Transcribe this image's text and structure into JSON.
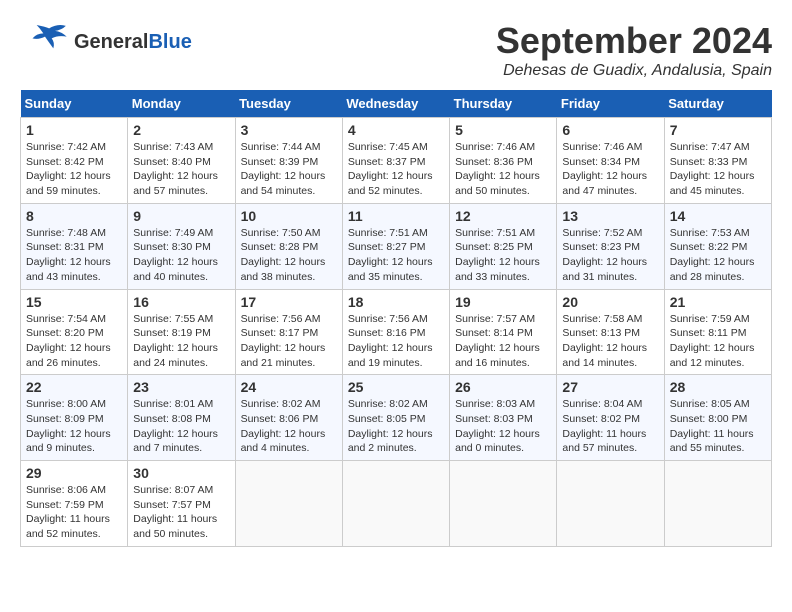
{
  "header": {
    "logo_general": "General",
    "logo_blue": "Blue",
    "month_title": "September 2024",
    "location": "Dehesas de Guadix, Andalusia, Spain"
  },
  "weekdays": [
    "Sunday",
    "Monday",
    "Tuesday",
    "Wednesday",
    "Thursday",
    "Friday",
    "Saturday"
  ],
  "weeks": [
    [
      {
        "day": "1",
        "sunrise": "7:42 AM",
        "sunset": "8:42 PM",
        "daylight": "12 hours and 59 minutes."
      },
      {
        "day": "2",
        "sunrise": "7:43 AM",
        "sunset": "8:40 PM",
        "daylight": "12 hours and 57 minutes."
      },
      {
        "day": "3",
        "sunrise": "7:44 AM",
        "sunset": "8:39 PM",
        "daylight": "12 hours and 54 minutes."
      },
      {
        "day": "4",
        "sunrise": "7:45 AM",
        "sunset": "8:37 PM",
        "daylight": "12 hours and 52 minutes."
      },
      {
        "day": "5",
        "sunrise": "7:46 AM",
        "sunset": "8:36 PM",
        "daylight": "12 hours and 50 minutes."
      },
      {
        "day": "6",
        "sunrise": "7:46 AM",
        "sunset": "8:34 PM",
        "daylight": "12 hours and 47 minutes."
      },
      {
        "day": "7",
        "sunrise": "7:47 AM",
        "sunset": "8:33 PM",
        "daylight": "12 hours and 45 minutes."
      }
    ],
    [
      {
        "day": "8",
        "sunrise": "7:48 AM",
        "sunset": "8:31 PM",
        "daylight": "12 hours and 43 minutes."
      },
      {
        "day": "9",
        "sunrise": "7:49 AM",
        "sunset": "8:30 PM",
        "daylight": "12 hours and 40 minutes."
      },
      {
        "day": "10",
        "sunrise": "7:50 AM",
        "sunset": "8:28 PM",
        "daylight": "12 hours and 38 minutes."
      },
      {
        "day": "11",
        "sunrise": "7:51 AM",
        "sunset": "8:27 PM",
        "daylight": "12 hours and 35 minutes."
      },
      {
        "day": "12",
        "sunrise": "7:51 AM",
        "sunset": "8:25 PM",
        "daylight": "12 hours and 33 minutes."
      },
      {
        "day": "13",
        "sunrise": "7:52 AM",
        "sunset": "8:23 PM",
        "daylight": "12 hours and 31 minutes."
      },
      {
        "day": "14",
        "sunrise": "7:53 AM",
        "sunset": "8:22 PM",
        "daylight": "12 hours and 28 minutes."
      }
    ],
    [
      {
        "day": "15",
        "sunrise": "7:54 AM",
        "sunset": "8:20 PM",
        "daylight": "12 hours and 26 minutes."
      },
      {
        "day": "16",
        "sunrise": "7:55 AM",
        "sunset": "8:19 PM",
        "daylight": "12 hours and 24 minutes."
      },
      {
        "day": "17",
        "sunrise": "7:56 AM",
        "sunset": "8:17 PM",
        "daylight": "12 hours and 21 minutes."
      },
      {
        "day": "18",
        "sunrise": "7:56 AM",
        "sunset": "8:16 PM",
        "daylight": "12 hours and 19 minutes."
      },
      {
        "day": "19",
        "sunrise": "7:57 AM",
        "sunset": "8:14 PM",
        "daylight": "12 hours and 16 minutes."
      },
      {
        "day": "20",
        "sunrise": "7:58 AM",
        "sunset": "8:13 PM",
        "daylight": "12 hours and 14 minutes."
      },
      {
        "day": "21",
        "sunrise": "7:59 AM",
        "sunset": "8:11 PM",
        "daylight": "12 hours and 12 minutes."
      }
    ],
    [
      {
        "day": "22",
        "sunrise": "8:00 AM",
        "sunset": "8:09 PM",
        "daylight": "12 hours and 9 minutes."
      },
      {
        "day": "23",
        "sunrise": "8:01 AM",
        "sunset": "8:08 PM",
        "daylight": "12 hours and 7 minutes."
      },
      {
        "day": "24",
        "sunrise": "8:02 AM",
        "sunset": "8:06 PM",
        "daylight": "12 hours and 4 minutes."
      },
      {
        "day": "25",
        "sunrise": "8:02 AM",
        "sunset": "8:05 PM",
        "daylight": "12 hours and 2 minutes."
      },
      {
        "day": "26",
        "sunrise": "8:03 AM",
        "sunset": "8:03 PM",
        "daylight": "12 hours and 0 minutes."
      },
      {
        "day": "27",
        "sunrise": "8:04 AM",
        "sunset": "8:02 PM",
        "daylight": "11 hours and 57 minutes."
      },
      {
        "day": "28",
        "sunrise": "8:05 AM",
        "sunset": "8:00 PM",
        "daylight": "11 hours and 55 minutes."
      }
    ],
    [
      {
        "day": "29",
        "sunrise": "8:06 AM",
        "sunset": "7:59 PM",
        "daylight": "11 hours and 52 minutes."
      },
      {
        "day": "30",
        "sunrise": "8:07 AM",
        "sunset": "7:57 PM",
        "daylight": "11 hours and 50 minutes."
      },
      null,
      null,
      null,
      null,
      null
    ]
  ]
}
